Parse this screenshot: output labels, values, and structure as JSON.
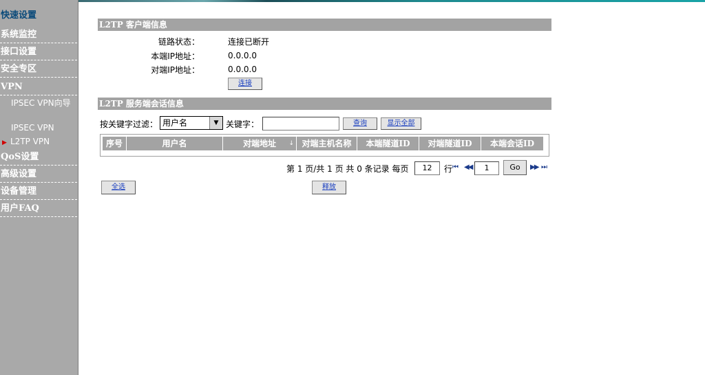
{
  "sidebar": {
    "items": [
      {
        "label": "快速设置",
        "active": true
      },
      {
        "label": "系统监控"
      },
      {
        "label": "接口设置"
      },
      {
        "label": "安全专区"
      },
      {
        "label": "VPN"
      },
      {
        "label": "QoS设置"
      },
      {
        "label": "高级设置"
      },
      {
        "label": "设备管理"
      },
      {
        "label": "用户FAQ"
      }
    ],
    "vpn_sub": [
      {
        "label": "IPSEC VPN向导"
      },
      {
        "label": "IPSEC VPN"
      },
      {
        "label": "L2TP VPN",
        "selected": true
      }
    ]
  },
  "client_info": {
    "title": "L2TP 客户端信息",
    "link_status_label": "链路状态：",
    "link_status_value": "连接已断开",
    "local_ip_label": "本端IP地址：",
    "local_ip_value": "0.0.0.0",
    "remote_ip_label": "对端IP地址：",
    "remote_ip_value": "0.0.0.0",
    "connect_button": "连接"
  },
  "server_info": {
    "title": "L2TP 服务端会话信息",
    "filter_label": "按关键字过滤：",
    "filter_selected": "用户名",
    "keyword_label": "关键字：",
    "keyword_value": "",
    "search_button": "查询",
    "show_all_button": "显示全部",
    "columns": [
      "序号",
      "用户名",
      "对端地址",
      "对端主机名称",
      "本端隧道ID",
      "对端隧道ID",
      "本端会话ID"
    ],
    "rows": []
  },
  "pager": {
    "summary": "第 1 页/共 1 页 共 0 条记录 每页",
    "per_page": "12",
    "rows_unit": "行",
    "page_input": "1",
    "go_button": "Go",
    "first_icon": "⏮",
    "prev_icon": "◀◀",
    "next_icon": "▶▶",
    "last_icon": "⏭"
  },
  "actions": {
    "select_all_button": "全选",
    "release_button": "释放"
  },
  "colors": {
    "sidebar_bg": "#a9a9a9",
    "header_bar": "#a3a3a3",
    "link_blue": "#1a3fbf",
    "active_nav": "#0a4a7a",
    "selected_arrow": "#d00000"
  }
}
